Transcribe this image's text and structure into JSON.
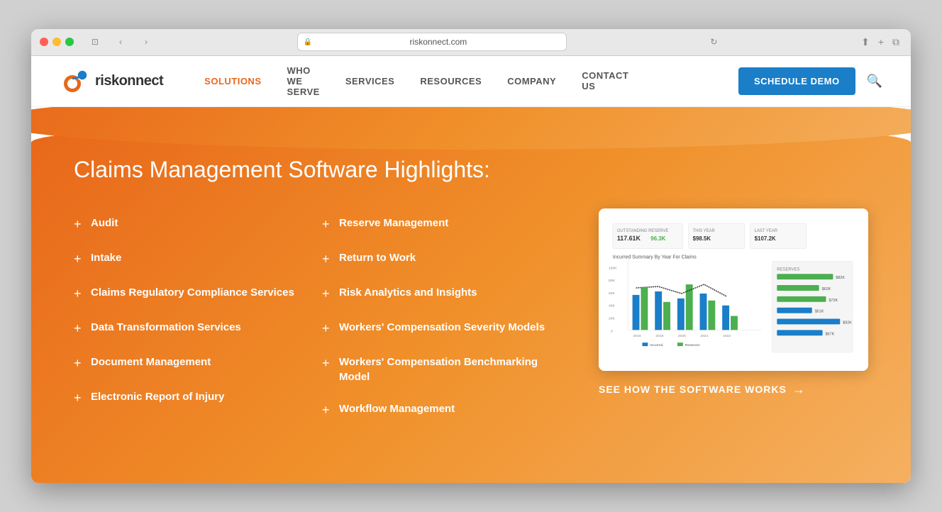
{
  "browser": {
    "url": "riskonnect.com",
    "tab_icon": "🔒"
  },
  "navbar": {
    "logo_text": "riskonnect",
    "links": [
      {
        "label": "SOLUTIONS",
        "active": true
      },
      {
        "label": "WHO WE SERVE",
        "active": false
      },
      {
        "label": "SERVICES",
        "active": false
      },
      {
        "label": "RESOURCES",
        "active": false
      },
      {
        "label": "COMPANY",
        "active": false
      },
      {
        "label": "CONTACT US",
        "active": false
      }
    ],
    "cta_label": "SCHEDULE DEMO"
  },
  "hero": {
    "title": "Claims Management Software Highlights:",
    "left_features": [
      "Audit",
      "Intake",
      "Claims Regulatory Compliance Services",
      "Data Transformation Services",
      "Document Management",
      "Electronic Report of Injury"
    ],
    "right_features": [
      "Reserve Management",
      "Return to Work",
      "Risk Analytics and Insights",
      "Workers' Compensation Severity Models",
      "Workers' Compensation Benchmarking Model",
      "Workflow Management"
    ],
    "see_how_label": "SEE HOW THE SOFTWARE WORKS",
    "see_how_arrow": "→"
  }
}
